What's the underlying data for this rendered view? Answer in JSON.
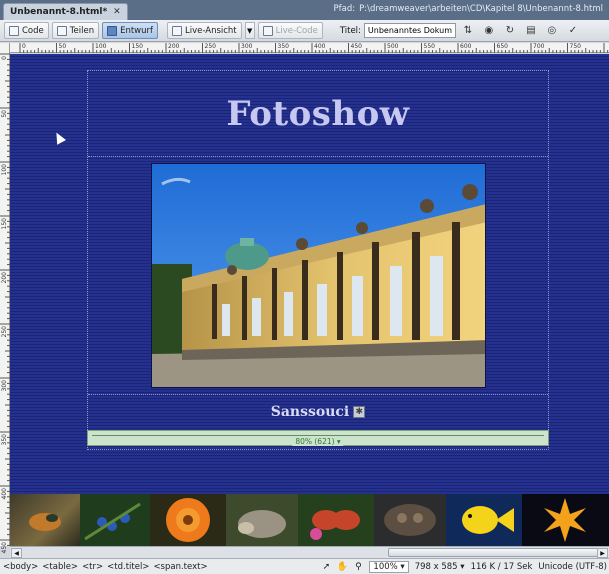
{
  "tab": {
    "label": "Unbenannt-8.html*",
    "close": "✕"
  },
  "path": {
    "label": "Pfad:",
    "value": "P:\\dreamweaver\\arbeiten\\CD\\Kapitel 8\\Unbenannt-8.html"
  },
  "toolbar": {
    "code": "Code",
    "split": "Teilen",
    "design": "Entwurf",
    "live_view": "Live-Ansicht",
    "live_code": "Live-Code",
    "title_label": "Titel:",
    "title_value": "Unbenanntes Dokument"
  },
  "ruler": {
    "h_ticks": [
      "0",
      "50",
      "100",
      "150",
      "200",
      "250",
      "300",
      "350",
      "400",
      "450",
      "500",
      "550",
      "600",
      "650",
      "700",
      "750"
    ],
    "v_ticks": [
      "0",
      "50",
      "100",
      "150",
      "200",
      "250",
      "300",
      "350",
      "400",
      "450"
    ]
  },
  "page": {
    "title": "Fotoshow",
    "caption": "Sanssouci",
    "caption_icon": "✱",
    "width_label": "80% (621) ▾"
  },
  "status": {
    "tags": [
      "<body>",
      "<table>",
      "<tr>",
      "<td.titel>",
      "<span.text>"
    ],
    "zoom": "100%",
    "window_size": "798 x 585",
    "file_info": "116 K / 17 Sek",
    "encoding": "Unicode (UTF-8)"
  },
  "colors": {
    "page_bg": "#25318f",
    "title": "#c6c8f2",
    "caption": "#d9dbf6"
  }
}
